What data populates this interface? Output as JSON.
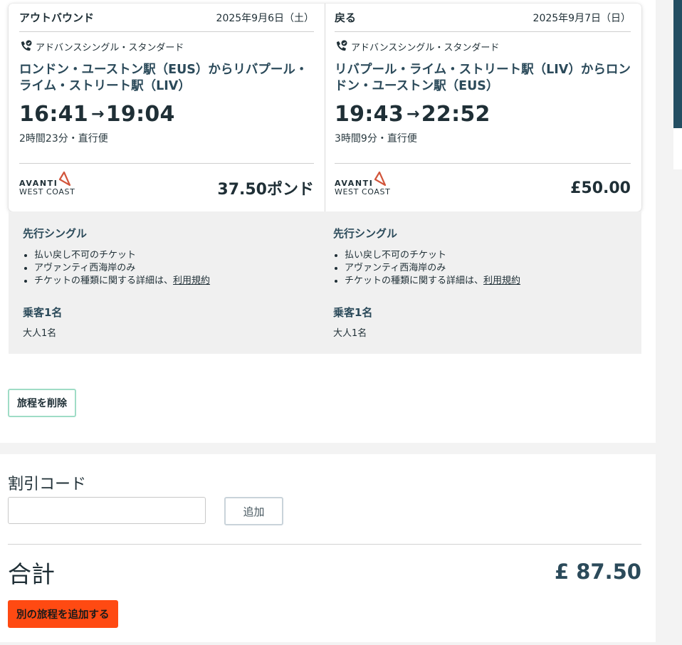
{
  "journey": {
    "outbound": {
      "direction": "アウトバウンド",
      "date": "2025年9月6日（土）",
      "fare_type": "アドバンスシングル・スタンダード",
      "route": "ロンドン・ユーストン駅（EUS）からリバプール・ライム・ストリート駅（LIV）",
      "depart": "16:41",
      "arrow": "→",
      "arrive": "19:04",
      "duration": "2時間23分・直行便",
      "operator_line1": "AVANTI",
      "operator_line2": "WEST COAST",
      "price": "37.50ポンド"
    },
    "return": {
      "direction": "戻る",
      "date": "2025年9月7日（日）",
      "fare_type": "アドバンスシングル・スタンダード",
      "route": "リバプール・ライム・ストリート駅（LIV）からロンドン・ユーストン駅（EUS）",
      "depart": "19:43",
      "arrow": "→",
      "arrive": "22:52",
      "duration": "3時間9分・直行便",
      "operator_line1": "AVANTI",
      "operator_line2": "WEST COAST",
      "price": "£50.00"
    }
  },
  "details": {
    "outbound": {
      "ticket_title": "先行シングル",
      "bullets": [
        "払い戻し不可のチケット",
        "アヴァンティ西海岸のみ"
      ],
      "terms_prefix": "チケットの種類に関する詳細は、",
      "terms_link": "利用規約",
      "pax_title": "乗客1名",
      "pax_detail": "大人1名"
    },
    "return": {
      "ticket_title": "先行シングル",
      "bullets": [
        "払い戻し不可のチケット",
        "アヴァンティ西海岸のみ"
      ],
      "terms_prefix": "チケットの種類に関する詳細は、",
      "terms_link": "利用規約",
      "pax_title": "乗客1名",
      "pax_detail": "大人1名"
    }
  },
  "actions": {
    "delete_label": "旅程を削除"
  },
  "discount": {
    "label": "割引コード",
    "input_value": "",
    "input_placeholder": "",
    "add_label": "追加"
  },
  "total": {
    "label": "合計",
    "value": "£ 87.50"
  },
  "add_another": {
    "label": "別の旅程を追加する"
  },
  "icons": {
    "fare": "phone-ticket-icon",
    "operator_logo": "avanti-logo-icon"
  },
  "colors": {
    "primary_text": "#1f2f36",
    "route_text": "#2b4a5a",
    "add_another_bg": "#ff4a12",
    "delete_border": "#9fdcc6",
    "logo_accent": "#d2553b",
    "side_bar": "#234e62"
  }
}
